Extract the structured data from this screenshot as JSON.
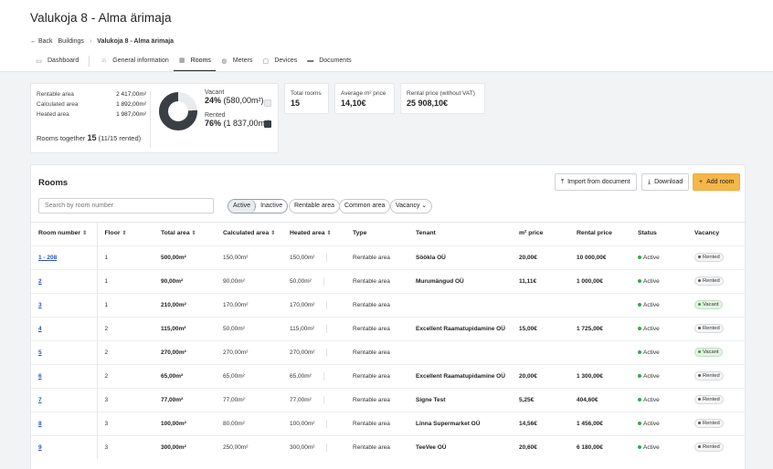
{
  "header": {
    "title": "Valukoja 8 - Alma ärimaja"
  },
  "breadcrumb": {
    "back": "Back",
    "buildings": "Buildings",
    "current": "Valukoja 8 - Alma ärimaja"
  },
  "tabs": [
    {
      "label": "Dashboard",
      "icon": "grid-icon"
    },
    {
      "label": "General information",
      "icon": "home-icon"
    },
    {
      "label": "Rooms",
      "icon": "rooms-icon",
      "active": true
    },
    {
      "label": "Meters",
      "icon": "meter-icon"
    },
    {
      "label": "Devices",
      "icon": "device-icon"
    },
    {
      "label": "Documents",
      "icon": "folder-icon"
    }
  ],
  "summary": {
    "areas": [
      {
        "label": "Rentable area",
        "value": "2 417,00m²"
      },
      {
        "label": "Calculated area",
        "value": "1 892,00m²"
      },
      {
        "label": "Heated area",
        "value": "1 987,00m²"
      }
    ],
    "together_label": "Rooms together",
    "together_count": "15",
    "together_rented": "(11/15 rented)",
    "vacant_label": "Vacant",
    "vacant_percent": "24%",
    "vacant_area": "(580,00m²)",
    "rented_label": "Rented",
    "rented_percent": "76%",
    "rented_area": "(1 837,00m²)",
    "rented_fraction": 0.76,
    "colors": {
      "vacant": "#e9eaec",
      "rented": "#3a3f46"
    }
  },
  "stats": [
    {
      "label": "Total rooms",
      "value": "15"
    },
    {
      "label": "Average m² price",
      "value": "14,10€"
    },
    {
      "label": "Rental price (without VAT)",
      "value": "25 908,10€"
    }
  ],
  "rooms": {
    "title": "Rooms",
    "import_label": "Import from document",
    "download_label": "Download",
    "add_label": "Add room",
    "search_placeholder": "Search by room number",
    "filter_active": "Active",
    "filter_inactive": "Inactive",
    "chip_rentable": "Rentable area",
    "chip_common": "Common area",
    "chip_vacancy": "Vacancy",
    "columns": [
      "Room number",
      "Floor",
      "Total area",
      "Calculated area",
      "Heated area",
      "Type",
      "Tenant",
      "m² price",
      "Rental price",
      "Status",
      "Vacancy"
    ],
    "rows": [
      {
        "room": "1 - 208",
        "floor": "1",
        "total": "500,00m²",
        "calc": "150,00m²",
        "heated": "150,00m²",
        "type": "Rentable area",
        "tenant": "Söökla OÜ",
        "price": "20,00€",
        "rental": "10 000,00€",
        "status": "Active",
        "vacancy": "Rented"
      },
      {
        "room": "2",
        "floor": "1",
        "total": "90,00m²",
        "calc": "90,00m²",
        "heated": "50,00m²",
        "type": "Rentable area",
        "tenant": "Murumängud OÜ",
        "price": "11,11€",
        "rental": "1 000,00€",
        "status": "Active",
        "vacancy": "Rented"
      },
      {
        "room": "3",
        "floor": "1",
        "total": "210,00m²",
        "calc": "170,00m²",
        "heated": "170,00m²",
        "type": "Rentable area",
        "tenant": "",
        "price": "",
        "rental": "",
        "status": "Active",
        "vacancy": "Vacant"
      },
      {
        "room": "4",
        "floor": "2",
        "total": "115,00m²",
        "calc": "50,00m²",
        "heated": "115,00m²",
        "type": "Rentable area",
        "tenant": "Excellent Raamatupidamine OÜ",
        "price": "15,00€",
        "rental": "1 725,00€",
        "status": "Active",
        "vacancy": "Rented"
      },
      {
        "room": "5",
        "floor": "2",
        "total": "270,00m²",
        "calc": "270,00m²",
        "heated": "270,00m²",
        "type": "Rentable area",
        "tenant": "",
        "price": "",
        "rental": "",
        "status": "Active",
        "vacancy": "Vacant"
      },
      {
        "room": "6",
        "floor": "2",
        "total": "65,00m²",
        "calc": "65,00m²",
        "heated": "65,00m²",
        "type": "Rentable area",
        "tenant": "Excellent Raamatupidamine OÜ",
        "price": "20,00€",
        "rental": "1 300,00€",
        "status": "Active",
        "vacancy": "Rented"
      },
      {
        "room": "7",
        "floor": "3",
        "total": "77,00m²",
        "calc": "77,00m²",
        "heated": "77,00m²",
        "type": "Rentable area",
        "tenant": "Signe Test",
        "price": "5,25€",
        "rental": "404,60€",
        "status": "Active",
        "vacancy": "Rented"
      },
      {
        "room": "8",
        "floor": "3",
        "total": "100,00m²",
        "calc": "80,00m²",
        "heated": "100,00m²",
        "type": "Rentable area",
        "tenant": "Linna Supermarket OÜ",
        "price": "14,56€",
        "rental": "1 456,00€",
        "status": "Active",
        "vacancy": "Rented"
      },
      {
        "room": "9",
        "floor": "3",
        "total": "300,00m²",
        "calc": "250,00m²",
        "heated": "300,00m²",
        "type": "Rentable area",
        "tenant": "TeeVee OÜ",
        "price": "20,60€",
        "rental": "6 180,00€",
        "status": "Active",
        "vacancy": "Rented"
      }
    ]
  }
}
